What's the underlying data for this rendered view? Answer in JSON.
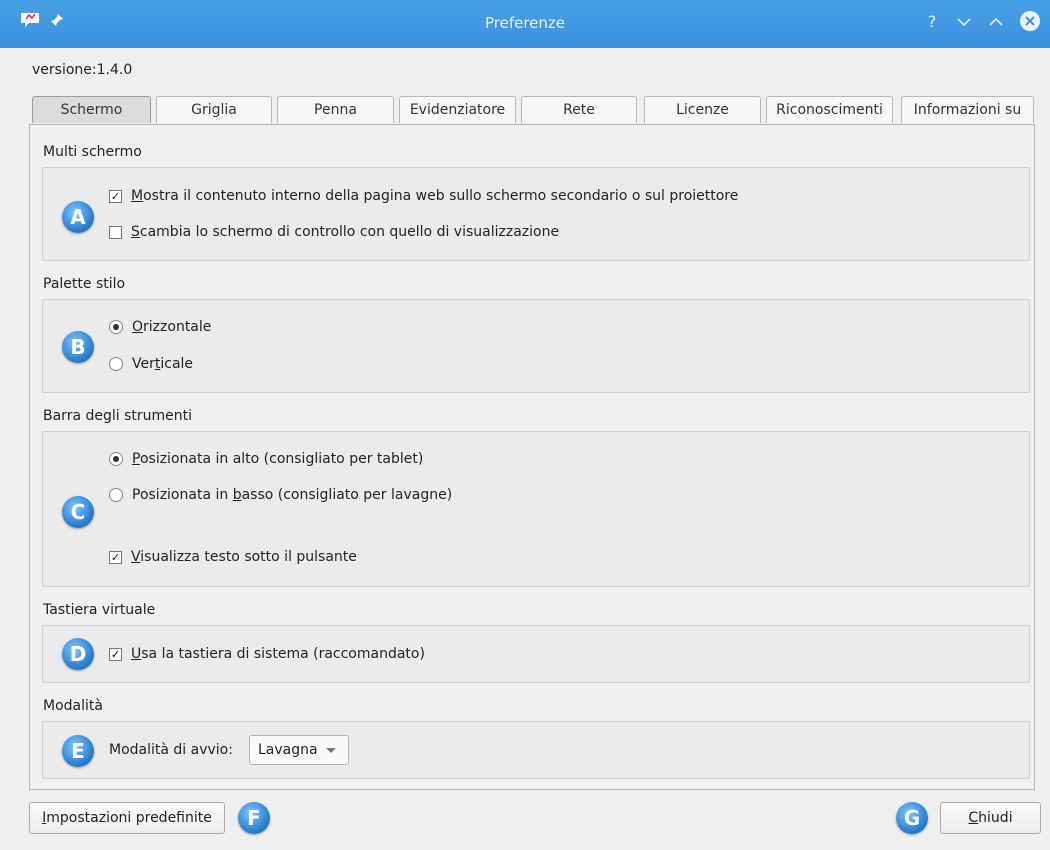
{
  "window": {
    "title": "Preferenze",
    "controls": {
      "help": "?",
      "minimize": "⌄",
      "maximize": "⌃"
    }
  },
  "version_label": "versione:1.4.0",
  "tabs": [
    {
      "label": "Schermo",
      "active": true
    },
    {
      "label": "Griglia",
      "active": false
    },
    {
      "label": "Penna",
      "active": false
    },
    {
      "label": "Evidenziatore",
      "active": false
    },
    {
      "label": "Rete",
      "active": false
    },
    {
      "label": "Licenze",
      "active": false
    },
    {
      "label": "Riconoscimenti",
      "active": false
    },
    {
      "label": "Informazioni su",
      "active": false
    }
  ],
  "sections": {
    "multi_screen": {
      "title": "Multi schermo",
      "badge": "A",
      "options": [
        {
          "accel": "M",
          "rest": "ostra il contenuto interno della pagina web sullo schermo secondario o sul proiettore",
          "checked": true
        },
        {
          "accel": "S",
          "rest": "cambia lo schermo di controllo con quello di visualizzazione",
          "checked": false
        }
      ]
    },
    "palette": {
      "title": "Palette stilo",
      "badge": "B",
      "options": [
        {
          "pre": "",
          "accel": "O",
          "rest": "rizzontale",
          "selected": true
        },
        {
          "pre": "Ver",
          "accel": "t",
          "rest": "icale",
          "selected": false
        }
      ]
    },
    "toolbar": {
      "title": "Barra degli strumenti",
      "badge": "C",
      "options": [
        {
          "pre": "",
          "accel": "P",
          "rest": "osizionata in alto (consigliato per tablet)",
          "selected": true
        },
        {
          "pre": "Posizionata in ",
          "accel": "b",
          "rest": "asso (consigliato per lavagne)",
          "selected": false
        }
      ],
      "show_text": {
        "accel": "V",
        "rest": "isualizza testo sotto il pulsante",
        "checked": true
      }
    },
    "keyboard": {
      "title": "Tastiera virtuale",
      "badge": "D",
      "option": {
        "accel": "U",
        "rest": "sa la tastiera di sistema (raccomandato)",
        "checked": true
      }
    },
    "mode": {
      "title": "Modalità",
      "badge": "E",
      "label": "Modalità di avvio:",
      "selected": "Lavagna"
    }
  },
  "footer": {
    "defaults_button": {
      "accel": "I",
      "rest": "mpostazioni predefinite"
    },
    "badge_f": "F",
    "badge_g": "G",
    "close_button": {
      "accel": "C",
      "rest": "hiudi"
    }
  },
  "colors": {
    "titlebar": "#3a91dd",
    "badge": "#2378c9"
  }
}
